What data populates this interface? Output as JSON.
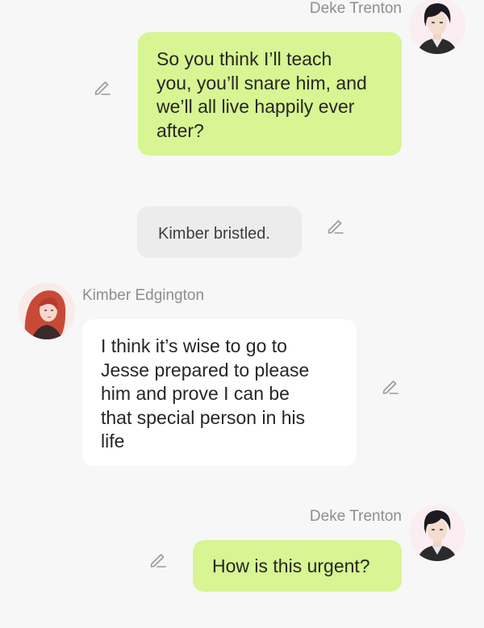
{
  "characters": {
    "user": {
      "name": "Deke Trenton",
      "avatar_icon": "avatar-dark-haired-man"
    },
    "bot": {
      "name": "Kimber Edgington",
      "avatar_icon": "avatar-red-haired-woman"
    }
  },
  "messages": [
    {
      "role": "user",
      "sender": "Deke Trenton",
      "text": "So you think I’ll teach\nyou, you’ll snare him, and\nwe’ll all live happily ever\nafter?"
    },
    {
      "role": "narration",
      "text": "Kimber bristled."
    },
    {
      "role": "bot",
      "sender": "Kimber Edgington",
      "text": "I think it’s wise to go to\nJesse prepared to please\nhim and prove I can be\nthat special person in his\nlife"
    },
    {
      "role": "user",
      "sender": "Deke Trenton",
      "text": "How is this urgent?"
    }
  ],
  "colors": {
    "background": "#f7f7f7",
    "user_bubble": "#d7f592",
    "bot_bubble": "#ffffff",
    "narration_bubble": "#ececec",
    "name_text": "#8e8e8e",
    "message_text": "#262626",
    "edit_icon": "#9a9a9a"
  }
}
